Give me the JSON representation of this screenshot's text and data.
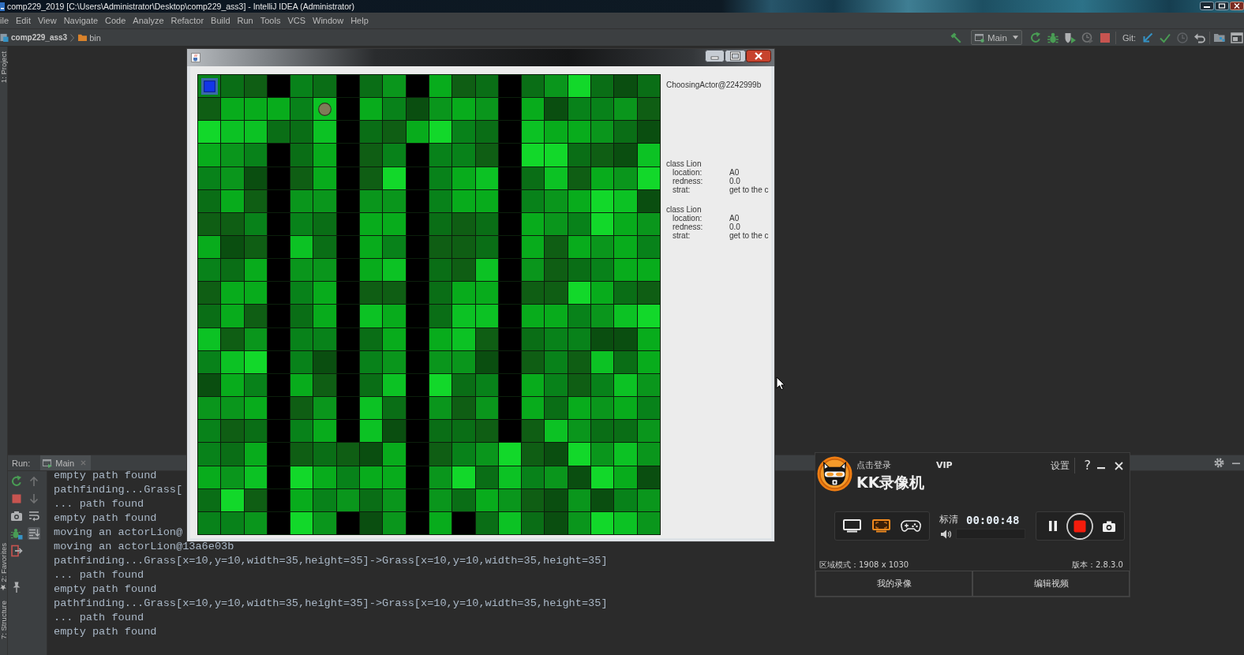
{
  "window": {
    "title": "comp229_2019 [C:\\Users\\Administrator\\Desktop\\comp229_ass3] - IntelliJ IDEA (Administrator)"
  },
  "menu": [
    "ile",
    "Edit",
    "View",
    "Navigate",
    "Code",
    "Analyze",
    "Refactor",
    "Build",
    "Run",
    "Tools",
    "VCS",
    "Window",
    "Help"
  ],
  "breadcrumbs": [
    {
      "kind": "project",
      "label": "comp229_ass3"
    },
    {
      "kind": "folder",
      "label": "bin"
    }
  ],
  "toolbar": {
    "run_config": "Main",
    "run_actions": [
      {
        "disabled": false
      },
      {
        "disabled": false
      },
      {
        "disabled": false
      },
      {
        "disabled": true
      },
      {
        "disabled": false
      }
    ],
    "git_label": "Git:"
  },
  "tool_tabs": {
    "top": [
      "1: Project"
    ],
    "bottom": [
      {
        "kind": "favorites",
        "label": "2: Favorites"
      },
      {
        "kind": "structure",
        "label": "7: Structure"
      }
    ]
  },
  "run_panel": {
    "label": "Run:",
    "tabs": [
      {
        "label": "Main",
        "selected": true
      }
    ],
    "scroll_actions": [
      {
        "disabled": true,
        "on": false
      },
      {
        "disabled": true,
        "on": false
      },
      {
        "disabled": false,
        "on": false
      },
      {
        "disabled": false,
        "on": true
      }
    ],
    "console": [
      "empty path found",
      "pathfinding...Grass[",
      "... path found",
      "empty path found",
      "moving an actorLion@",
      "moving an actorLion@13a6e03b",
      "pathfinding...Grass[x=10,y=10,width=35,height=35]->Grass[x=10,y=10,width=35,height=35]",
      "... path found",
      "empty path found",
      "pathfinding...Grass[x=10,y=10,width=35,height=35]->Grass[x=10,y=10,width=35,height=35]",
      "... path found",
      "empty path found"
    ]
  },
  "app_window": {
    "grid": {
      "rows": [
        [
          {
            "color": "#08821a",
            "piece": {
              "kind": "square"
            }
          },
          {
            "color": "#0a6e16"
          },
          {
            "color": "#0f5e14"
          },
          {
            "color": "#000000"
          },
          {
            "color": "#08821a"
          },
          {
            "color": "#0a6e16"
          },
          {
            "color": "#000000"
          },
          {
            "color": "#0a6e16"
          },
          {
            "color": "#0a961c"
          },
          {
            "color": "#000000"
          },
          {
            "color": "#08ac1c"
          },
          {
            "color": "#0f5e14"
          },
          {
            "color": "#0a6e16"
          },
          {
            "color": "#000000"
          },
          {
            "color": "#0a6e16"
          },
          {
            "color": "#0a961c"
          },
          {
            "color": "#12d82a"
          },
          {
            "color": "#0a6e16"
          },
          {
            "color": "#0a4e10"
          },
          {
            "color": "#0a6e16"
          }
        ],
        [
          {
            "color": "#0f5e14"
          },
          {
            "color": "#08ac1c"
          },
          {
            "color": "#08ac1c"
          },
          {
            "color": "#08ac1c"
          },
          {
            "color": "#08821a"
          },
          {
            "color": "#0cc224",
            "piece": {
              "kind": "circle"
            }
          },
          {
            "color": "#000000"
          },
          {
            "color": "#08ac1c"
          },
          {
            "color": "#08821a"
          },
          {
            "color": "#0a4e10"
          },
          {
            "color": "#0a961c"
          },
          {
            "color": "#08ac1c"
          },
          {
            "color": "#0a961c"
          },
          {
            "color": "#000000"
          },
          {
            "color": "#08ac1c"
          },
          {
            "color": "#0a4e10"
          },
          {
            "color": "#08821a"
          },
          {
            "color": "#08821a"
          },
          {
            "color": "#0a961c"
          },
          {
            "color": "#0f5e14"
          }
        ],
        [
          {
            "color": "#12d82a"
          },
          {
            "color": "#0cc224"
          },
          {
            "color": "#0cc224"
          },
          {
            "color": "#0a6e16"
          },
          {
            "color": "#0a6e16"
          },
          {
            "color": "#0cc224"
          },
          {
            "color": "#000000"
          },
          {
            "color": "#0a6e16"
          },
          {
            "color": "#0f5e14"
          },
          {
            "color": "#08ac1c"
          },
          {
            "color": "#12d82a"
          },
          {
            "color": "#08821a"
          },
          {
            "color": "#0a6e16"
          },
          {
            "color": "#000000"
          },
          {
            "color": "#0cc224"
          },
          {
            "color": "#08ac1c"
          },
          {
            "color": "#08ac1c"
          },
          {
            "color": "#0a961c"
          },
          {
            "color": "#0a6e16"
          },
          {
            "color": "#0a4e10"
          }
        ],
        [
          {
            "color": "#08ac1c"
          },
          {
            "color": "#0a961c"
          },
          {
            "color": "#08821a"
          },
          {
            "color": "#000000"
          },
          {
            "color": "#0a6e16"
          },
          {
            "color": "#08ac1c"
          },
          {
            "color": "#000000"
          },
          {
            "color": "#0f5e14"
          },
          {
            "color": "#08821a"
          },
          {
            "color": "#000000"
          },
          {
            "color": "#08821a"
          },
          {
            "color": "#08821a"
          },
          {
            "color": "#0f5e14"
          },
          {
            "color": "#000000"
          },
          {
            "color": "#12d82a"
          },
          {
            "color": "#12d82a"
          },
          {
            "color": "#0a6e16"
          },
          {
            "color": "#0f5e14"
          },
          {
            "color": "#0a4e10"
          },
          {
            "color": "#0cc224"
          }
        ],
        [
          {
            "color": "#08821a"
          },
          {
            "color": "#0a961c"
          },
          {
            "color": "#0a4e10"
          },
          {
            "color": "#000000"
          },
          {
            "color": "#0f5e14"
          },
          {
            "color": "#08ac1c"
          },
          {
            "color": "#000000"
          },
          {
            "color": "#0f5e14"
          },
          {
            "color": "#12d82a"
          },
          {
            "color": "#000000"
          },
          {
            "color": "#08821a"
          },
          {
            "color": "#08ac1c"
          },
          {
            "color": "#0cc224"
          },
          {
            "color": "#000000"
          },
          {
            "color": "#0a6e16"
          },
          {
            "color": "#0cc224"
          },
          {
            "color": "#0f5e14"
          },
          {
            "color": "#08ac1c"
          },
          {
            "color": "#0a961c"
          },
          {
            "color": "#12d82a"
          }
        ],
        [
          {
            "color": "#0a6e16"
          },
          {
            "color": "#08ac1c"
          },
          {
            "color": "#0f5e14"
          },
          {
            "color": "#000000"
          },
          {
            "color": "#0a961c"
          },
          {
            "color": "#0a961c"
          },
          {
            "color": "#000000"
          },
          {
            "color": "#0a961c"
          },
          {
            "color": "#0a961c"
          },
          {
            "color": "#000000"
          },
          {
            "color": "#08821a"
          },
          {
            "color": "#08ac1c"
          },
          {
            "color": "#08ac1c"
          },
          {
            "color": "#000000"
          },
          {
            "color": "#08821a"
          },
          {
            "color": "#0a961c"
          },
          {
            "color": "#08ac1c"
          },
          {
            "color": "#12d82a"
          },
          {
            "color": "#0cc224"
          },
          {
            "color": "#0a4e10"
          }
        ],
        [
          {
            "color": "#0f5e14"
          },
          {
            "color": "#0f5e14"
          },
          {
            "color": "#08821a"
          },
          {
            "color": "#000000"
          },
          {
            "color": "#08821a"
          },
          {
            "color": "#0a6e16"
          },
          {
            "color": "#000000"
          },
          {
            "color": "#08ac1c"
          },
          {
            "color": "#08ac1c"
          },
          {
            "color": "#000000"
          },
          {
            "color": "#0a6e16"
          },
          {
            "color": "#0f5e14"
          },
          {
            "color": "#0a6e16"
          },
          {
            "color": "#000000"
          },
          {
            "color": "#08ac1c"
          },
          {
            "color": "#0a961c"
          },
          {
            "color": "#08821a"
          },
          {
            "color": "#12d82a"
          },
          {
            "color": "#08ac1c"
          },
          {
            "color": "#0a961c"
          }
        ],
        [
          {
            "color": "#08ac1c"
          },
          {
            "color": "#0a4e10"
          },
          {
            "color": "#0f5e14"
          },
          {
            "color": "#000000"
          },
          {
            "color": "#0cc224"
          },
          {
            "color": "#0a6e16"
          },
          {
            "color": "#000000"
          },
          {
            "color": "#08ac1c"
          },
          {
            "color": "#08821a"
          },
          {
            "color": "#000000"
          },
          {
            "color": "#0f5e14"
          },
          {
            "color": "#0f5e14"
          },
          {
            "color": "#0a6e16"
          },
          {
            "color": "#000000"
          },
          {
            "color": "#08ac1c"
          },
          {
            "color": "#0f5e14"
          },
          {
            "color": "#08ac1c"
          },
          {
            "color": "#0a961c"
          },
          {
            "color": "#08ac1c"
          },
          {
            "color": "#08821a"
          }
        ],
        [
          {
            "color": "#08821a"
          },
          {
            "color": "#0a6e16"
          },
          {
            "color": "#08ac1c"
          },
          {
            "color": "#000000"
          },
          {
            "color": "#0a961c"
          },
          {
            "color": "#0a961c"
          },
          {
            "color": "#000000"
          },
          {
            "color": "#08ac1c"
          },
          {
            "color": "#0cc224"
          },
          {
            "color": "#000000"
          },
          {
            "color": "#0a6e16"
          },
          {
            "color": "#0f5e14"
          },
          {
            "color": "#0cc224"
          },
          {
            "color": "#000000"
          },
          {
            "color": "#0a961c"
          },
          {
            "color": "#0f5e14"
          },
          {
            "color": "#0a6e16"
          },
          {
            "color": "#08821a"
          },
          {
            "color": "#08ac1c"
          },
          {
            "color": "#08ac1c"
          }
        ],
        [
          {
            "color": "#0f5e14"
          },
          {
            "color": "#08ac1c"
          },
          {
            "color": "#08ac1c"
          },
          {
            "color": "#000000"
          },
          {
            "color": "#08821a"
          },
          {
            "color": "#08ac1c"
          },
          {
            "color": "#000000"
          },
          {
            "color": "#0f5e14"
          },
          {
            "color": "#0f5e14"
          },
          {
            "color": "#000000"
          },
          {
            "color": "#0a6e16"
          },
          {
            "color": "#08ac1c"
          },
          {
            "color": "#08ac1c"
          },
          {
            "color": "#000000"
          },
          {
            "color": "#0f5e14"
          },
          {
            "color": "#0f5e14"
          },
          {
            "color": "#12d82a"
          },
          {
            "color": "#08ac1c"
          },
          {
            "color": "#0a6e16"
          },
          {
            "color": "#0f5e14"
          }
        ],
        [
          {
            "color": "#0a6e16"
          },
          {
            "color": "#08ac1c"
          },
          {
            "color": "#0f5e14"
          },
          {
            "color": "#000000"
          },
          {
            "color": "#0a6e16"
          },
          {
            "color": "#08ac1c"
          },
          {
            "color": "#000000"
          },
          {
            "color": "#0cc224"
          },
          {
            "color": "#08ac1c"
          },
          {
            "color": "#000000"
          },
          {
            "color": "#0a6e16"
          },
          {
            "color": "#0cc224"
          },
          {
            "color": "#0cc224"
          },
          {
            "color": "#000000"
          },
          {
            "color": "#08ac1c"
          },
          {
            "color": "#08ac1c"
          },
          {
            "color": "#08821a"
          },
          {
            "color": "#0a961c"
          },
          {
            "color": "#0cc224"
          },
          {
            "color": "#12d82a"
          }
        ],
        [
          {
            "color": "#0cc224"
          },
          {
            "color": "#0f5e14"
          },
          {
            "color": "#0a961c"
          },
          {
            "color": "#000000"
          },
          {
            "color": "#08821a"
          },
          {
            "color": "#08821a"
          },
          {
            "color": "#000000"
          },
          {
            "color": "#0a6e16"
          },
          {
            "color": "#08ac1c"
          },
          {
            "color": "#000000"
          },
          {
            "color": "#08ac1c"
          },
          {
            "color": "#0cc224"
          },
          {
            "color": "#0f5e14"
          },
          {
            "color": "#000000"
          },
          {
            "color": "#0a6e16"
          },
          {
            "color": "#08821a"
          },
          {
            "color": "#08821a"
          },
          {
            "color": "#0a4e10"
          },
          {
            "color": "#0a4e10"
          },
          {
            "color": "#08ac1c"
          }
        ],
        [
          {
            "color": "#08821a"
          },
          {
            "color": "#0cc224"
          },
          {
            "color": "#12d82a"
          },
          {
            "color": "#000000"
          },
          {
            "color": "#08821a"
          },
          {
            "color": "#0a4e10"
          },
          {
            "color": "#000000"
          },
          {
            "color": "#08821a"
          },
          {
            "color": "#0a961c"
          },
          {
            "color": "#000000"
          },
          {
            "color": "#0a961c"
          },
          {
            "color": "#0a961c"
          },
          {
            "color": "#0a4e10"
          },
          {
            "color": "#000000"
          },
          {
            "color": "#0f5e14"
          },
          {
            "color": "#08821a"
          },
          {
            "color": "#0f5e14"
          },
          {
            "color": "#0cc224"
          },
          {
            "color": "#0a6e16"
          },
          {
            "color": "#08ac1c"
          }
        ],
        [
          {
            "color": "#0a4e10"
          },
          {
            "color": "#08ac1c"
          },
          {
            "color": "#08821a"
          },
          {
            "color": "#000000"
          },
          {
            "color": "#08ac1c"
          },
          {
            "color": "#0f5e14"
          },
          {
            "color": "#000000"
          },
          {
            "color": "#0a6e16"
          },
          {
            "color": "#0cc224"
          },
          {
            "color": "#000000"
          },
          {
            "color": "#12d82a"
          },
          {
            "color": "#0a6e16"
          },
          {
            "color": "#08821a"
          },
          {
            "color": "#000000"
          },
          {
            "color": "#08ac1c"
          },
          {
            "color": "#08821a"
          },
          {
            "color": "#0f5e14"
          },
          {
            "color": "#08821a"
          },
          {
            "color": "#0cc224"
          },
          {
            "color": "#0a961c"
          }
        ],
        [
          {
            "color": "#0a961c"
          },
          {
            "color": "#0a961c"
          },
          {
            "color": "#08ac1c"
          },
          {
            "color": "#000000"
          },
          {
            "color": "#0f5e14"
          },
          {
            "color": "#0a961c"
          },
          {
            "color": "#000000"
          },
          {
            "color": "#0cc224"
          },
          {
            "color": "#0a6e16"
          },
          {
            "color": "#000000"
          },
          {
            "color": "#0a961c"
          },
          {
            "color": "#0f5e14"
          },
          {
            "color": "#0a961c"
          },
          {
            "color": "#000000"
          },
          {
            "color": "#08ac1c"
          },
          {
            "color": "#0a6e16"
          },
          {
            "color": "#08ac1c"
          },
          {
            "color": "#0a961c"
          },
          {
            "color": "#08ac1c"
          },
          {
            "color": "#08821a"
          }
        ],
        [
          {
            "color": "#08821a"
          },
          {
            "color": "#0f5e14"
          },
          {
            "color": "#0a6e16"
          },
          {
            "color": "#000000"
          },
          {
            "color": "#08821a"
          },
          {
            "color": "#08ac1c"
          },
          {
            "color": "#000000"
          },
          {
            "color": "#0cc224"
          },
          {
            "color": "#0a4e10"
          },
          {
            "color": "#000000"
          },
          {
            "color": "#0a6e16"
          },
          {
            "color": "#0a6e16"
          },
          {
            "color": "#0f5e14"
          },
          {
            "color": "#000000"
          },
          {
            "color": "#0f5e14"
          },
          {
            "color": "#0cc224"
          },
          {
            "color": "#0a961c"
          },
          {
            "color": "#0a6e16"
          },
          {
            "color": "#0a6e16"
          },
          {
            "color": "#0a961c"
          }
        ],
        [
          {
            "color": "#08821a"
          },
          {
            "color": "#0a6e16"
          },
          {
            "color": "#08ac1c"
          },
          {
            "color": "#000000"
          },
          {
            "color": "#0f5e14"
          },
          {
            "color": "#0a6e16"
          },
          {
            "color": "#0f5e14"
          },
          {
            "color": "#0a4e10"
          },
          {
            "color": "#08ac1c"
          },
          {
            "color": "#000000"
          },
          {
            "color": "#0f5e14"
          },
          {
            "color": "#08821a"
          },
          {
            "color": "#0a961c"
          },
          {
            "color": "#12d82a"
          },
          {
            "color": "#0f5e14"
          },
          {
            "color": "#0a4e10"
          },
          {
            "color": "#12d82a"
          },
          {
            "color": "#0a961c"
          },
          {
            "color": "#0cc224"
          },
          {
            "color": "#0a961c"
          }
        ],
        [
          {
            "color": "#08ac1c"
          },
          {
            "color": "#0a961c"
          },
          {
            "color": "#0cc224"
          },
          {
            "color": "#000000"
          },
          {
            "color": "#12d82a"
          },
          {
            "color": "#08ac1c"
          },
          {
            "color": "#08821a"
          },
          {
            "color": "#08ac1c"
          },
          {
            "color": "#08ac1c"
          },
          {
            "color": "#000000"
          },
          {
            "color": "#0a961c"
          },
          {
            "color": "#12d82a"
          },
          {
            "color": "#0a6e16"
          },
          {
            "color": "#0cc224"
          },
          {
            "color": "#08821a"
          },
          {
            "color": "#0a961c"
          },
          {
            "color": "#0a4e10"
          },
          {
            "color": "#12d82a"
          },
          {
            "color": "#08ac1c"
          },
          {
            "color": "#0a4e10"
          }
        ],
        [
          {
            "color": "#0a6e16"
          },
          {
            "color": "#12d82a"
          },
          {
            "color": "#0f5e14"
          },
          {
            "color": "#000000"
          },
          {
            "color": "#08ac1c"
          },
          {
            "color": "#08821a"
          },
          {
            "color": "#0a961c"
          },
          {
            "color": "#0a6e16"
          },
          {
            "color": "#0a961c"
          },
          {
            "color": "#000000"
          },
          {
            "color": "#0a961c"
          },
          {
            "color": "#0a6e16"
          },
          {
            "color": "#08ac1c"
          },
          {
            "color": "#0a961c"
          },
          {
            "color": "#0f5e14"
          },
          {
            "color": "#0a4e10"
          },
          {
            "color": "#0a961c"
          },
          {
            "color": "#0a4e10"
          },
          {
            "color": "#08821a"
          },
          {
            "color": "#0a961c"
          }
        ],
        [
          {
            "color": "#08821a"
          },
          {
            "color": "#08821a"
          },
          {
            "color": "#0a961c"
          },
          {
            "color": "#000000"
          },
          {
            "color": "#12d82a"
          },
          {
            "color": "#0a961c"
          },
          {
            "color": "#000000"
          },
          {
            "color": "#0a4e10"
          },
          {
            "color": "#0a961c"
          },
          {
            "color": "#000000"
          },
          {
            "color": "#08ac1c"
          },
          {
            "color": "#000000"
          },
          {
            "color": "#0a6e16"
          },
          {
            "color": "#0cc224"
          },
          {
            "color": "#0a6e16"
          },
          {
            "color": "#0a4e10"
          },
          {
            "color": "#0a961c"
          },
          {
            "color": "#12d82a"
          },
          {
            "color": "#0cc224"
          },
          {
            "color": "#0a961c"
          }
        ]
      ]
    },
    "info": {
      "actor": "ChoosingActor@2242999b",
      "entries": [
        {
          "title": "class Lion",
          "fields": [
            {
              "name": "location:",
              "value": "A0"
            },
            {
              "name": "redness:",
              "value": "0.0"
            },
            {
              "name": "strat:",
              "value": "get to the c"
            }
          ]
        },
        {
          "title": "class Lion",
          "fields": [
            {
              "name": "location:",
              "value": "A0"
            },
            {
              "name": "redness:",
              "value": "0.0"
            },
            {
              "name": "strat:",
              "value": "get to the c"
            }
          ]
        }
      ]
    }
  },
  "recorder": {
    "login": "点击登录",
    "vip": "VIP",
    "brand": "KK录像机",
    "settings": "设置",
    "help": "?",
    "modes": [
      {
        "selected": false
      },
      {
        "selected": true
      },
      {
        "selected": false
      }
    ],
    "quality": "标清",
    "timer": "00:00:48",
    "region": "区域模式：1908 x 1030",
    "version": "版本：2.8.3.0",
    "buttons": [
      "我的录像",
      "编辑视频"
    ]
  }
}
